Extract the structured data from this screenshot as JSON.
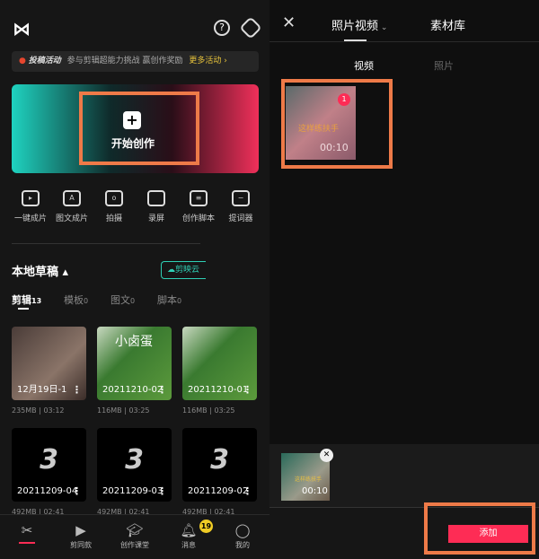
{
  "left": {
    "banner": {
      "title": "投稿活动",
      "text": "参与剪辑超能力挑战 赢创作奖励",
      "more": "更多活动 ›"
    },
    "create_label": "开始创作",
    "tools": [
      "一键成片",
      "图文成片",
      "拍摄",
      "录屏",
      "创作脚本",
      "提词器"
    ],
    "drafts_title": "本地草稿 ▴",
    "cloud_label": "剪映云",
    "tabs": [
      {
        "label": "剪辑",
        "count": "13"
      },
      {
        "label": "模板",
        "count": "0"
      },
      {
        "label": "图文",
        "count": "0"
      },
      {
        "label": "脚本",
        "count": "0"
      }
    ],
    "drafts": [
      {
        "name": "12月19日-1",
        "meta": "235MB | 03:12"
      },
      {
        "name": "20211210-02",
        "meta": "116MB | 03:25",
        "overlay": "小卤蛋"
      },
      {
        "name": "20211210-01",
        "meta": "116MB | 03:25"
      },
      {
        "name": "20211209-04",
        "meta": "492MB | 02:41",
        "overlay": "3"
      },
      {
        "name": "20211209-03",
        "meta": "492MB | 02:41",
        "overlay": "3"
      },
      {
        "name": "20211209-02",
        "meta": "492MB | 02:41",
        "overlay": "3"
      }
    ],
    "nav": [
      "",
      "剪同款",
      "创作课堂",
      "消息",
      "我的"
    ],
    "badge": "19"
  },
  "right": {
    "tabs": [
      "照片视频",
      "素材库"
    ],
    "subtabs": [
      "视频",
      "照片"
    ],
    "media": {
      "duration": "00:10",
      "index": "1",
      "caption": "这样练扶手"
    },
    "selected": {
      "duration": "00:10",
      "caption": "这样练扶手"
    },
    "add_label": "添加"
  },
  "colors": {
    "accent": "#fe2c55",
    "highlight": "#ee7a48",
    "teal": "#2fcfb5"
  }
}
